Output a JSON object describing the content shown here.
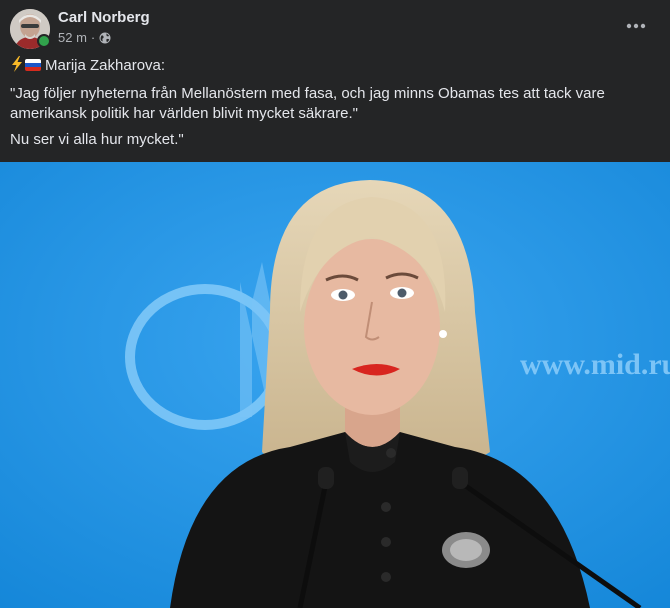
{
  "post": {
    "author": "Carl Norberg",
    "time": "52 m",
    "separator": "·",
    "lines": [
      "Marija Zakharova:",
      "\"Jag följer nyheterna från Mellanöstern med fasa, och jag minns Obamas tes att tack vare amerikansk politik har världen blivit mycket säkrare.\"",
      "Nu ser vi alla hur mycket.\""
    ],
    "photo_overlay_text": "www.mid.ru",
    "icons": {
      "bolt": "lightning-bolt-emoji",
      "flag": "russia-flag-emoji",
      "audience": "globe-icon",
      "more": "more-options-icon"
    }
  },
  "colors": {
    "card_bg": "#242526",
    "text_primary": "#e4e6eb",
    "text_secondary": "#b0b3b8",
    "online": "#31a24c",
    "photo_bg": "#1f8fe0"
  }
}
